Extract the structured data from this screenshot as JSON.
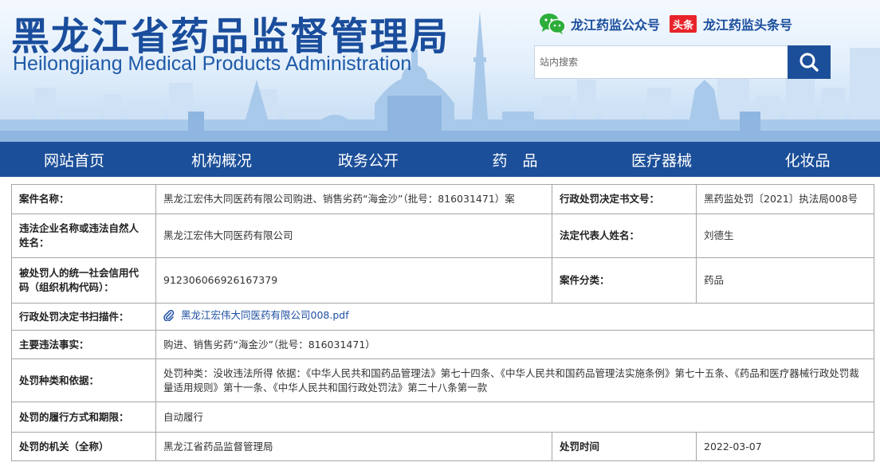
{
  "header": {
    "title_cn": "黑龙江省药品监督管理局",
    "title_en": "Heilongjiang Medical Products Administration",
    "wechat_icon": "wechat-icon",
    "wechat_label": "龙江药监公众号",
    "toutiao_badge": "头条",
    "toutiao_label": "龙江药监头条号",
    "search": {
      "placeholder": "站内搜索",
      "value": "",
      "button_icon": "search-icon"
    }
  },
  "nav": {
    "items": [
      {
        "label": "网站首页"
      },
      {
        "label": "机构概况"
      },
      {
        "label": "政务公开"
      },
      {
        "label": "药　品"
      },
      {
        "label": "医疗器械"
      },
      {
        "label": "化妆品"
      }
    ]
  },
  "record": {
    "case_name_label": "案件名称：",
    "case_name_value": "黑龙江宏伟大同医药有限公司购进、销售劣药“海金沙”（批号：816031471）案",
    "decision_no_label": "行政处罚决定书文号：",
    "decision_no_value": "黑药监处罚〔2021〕执法局008号",
    "company_label": "违法企业名称或违法自然人姓名：",
    "company_value": "黑龙江宏伟大同医药有限公司",
    "legal_rep_label": "法定代表人姓名：",
    "legal_rep_value": "刘德生",
    "credit_code_label": "被处罚人的统一社会信用代码（组织机构代码）：",
    "credit_code_value": "912306066926167379",
    "category_label": "案件分类：",
    "category_value": "药品",
    "attachment_label": "行政处罚决定书扫描件：",
    "attachment_icon": "paperclip-icon",
    "attachment_value": "黑龙江宏伟大同医药有限公司008.pdf",
    "facts_label": "主要违法事实：",
    "facts_value": "购进、销售劣药“海金沙”（批号：816031471）",
    "penalty_basis_label": "处罚种类和依据：",
    "penalty_basis_value": "处罚种类：没收违法所得 依据：《中华人民共和国药品管理法》第七十四条、《中华人民共和国药品管理法实施条例》第七十五条、《药品和医疗器械行政处罚裁量适用规则》第十一条、《中华人民共和国行政处罚法》第二十八条第一款",
    "fulfillment_label": "处罚的履行方式和期限：",
    "fulfillment_value": "自动履行",
    "authority_label": "处罚的机关（全称）",
    "authority_value": "黑龙江省药品监督管理局",
    "time_label": "处罚时间",
    "time_value": "2022-03-07"
  },
  "colors": {
    "brand_blue": "#1c4f99",
    "link_blue": "#1d4fa2",
    "title_blue": "#1a4d9c",
    "toutiao_red": "#e8242a",
    "wechat_green": "#2dae3b"
  }
}
